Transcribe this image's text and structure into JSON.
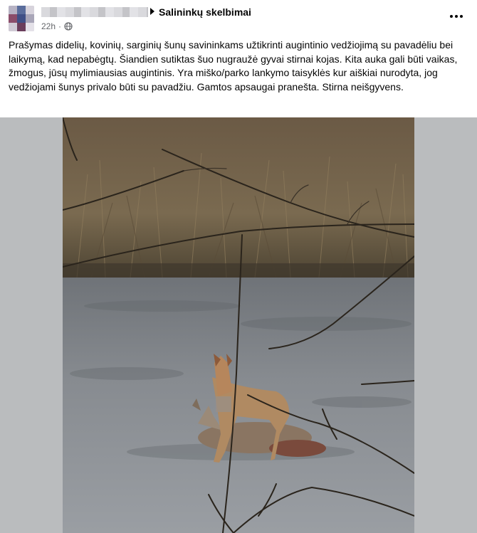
{
  "header": {
    "group_name": "Salininkų skelbimai",
    "timestamp": "22h",
    "privacy_icon": "globe-icon",
    "more_icon": "more-options-icon"
  },
  "post": {
    "text": "Prašymas didelių, kovinių, sarginių šunų savininkams užtikrinti augintinio vedžiojimą su pavadėliu bei laikymą, kad nepabėgtų. Šiandien sutiktas šuo nugraužė gyvai stirnai kojas. Kita auka gali būti vaikas, žmogus, jūsų mylimiausias augintinis. Yra miško/parko lankymo taisyklės kur aiškiai nurodyta, jog vedžiojami šunys privalo būti su pavadžiu. Gamtos apsaugai pranešta. Stirna neišgyvens."
  },
  "colors": {
    "text": "#050505",
    "secondary_text": "#65676b",
    "media_backdrop": "#babcbe"
  }
}
